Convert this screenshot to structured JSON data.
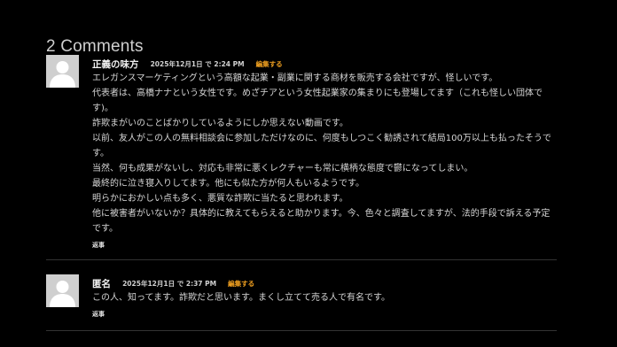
{
  "comments_title": "2 Comments",
  "comments": [
    {
      "author": "正義の味方",
      "date": "2025年12月1日 で 2:24 PM",
      "edit_label": "編集する",
      "paragraphs": [
        "エレガンスマーケティングという高額な起業・副業に関する商材を販売する会社ですが、怪しいです。",
        "代表者は、高橋ナナという女性です。めざチアという女性起業家の集まりにも登場してます（これも怪しい団体です)。",
        "詐欺まがいのことばかりしているようにしか思えない動画です。",
        "以前、友人がこの人の無料相談会に参加しただけなのに、何度もしつこく勧誘されて結局100万以上も払ったそうです。",
        "当然、何も成果がないし、対応も非常に悪くレクチャーも常に横柄な態度で鬱になってしまい。",
        "最終的に泣き寝入りしてます。他にも似た方が何人もいるようです。",
        "明らかにおかしい点も多く、悪質な詐欺に当たると思われます。",
        "他に被害者がいないか？具体的に教えてもらえると助かります。今、色々と調査してますが、法的手段で訴える予定です。"
      ],
      "reply_label": "返事"
    },
    {
      "author": "匿名",
      "date": "2025年12月1日 で 2:37 PM",
      "edit_label": "編集する",
      "paragraphs": [
        "この人、知ってます。詐欺だと思います。まくし立てて売る人で有名です。"
      ],
      "reply_label": "返事"
    }
  ],
  "colors": {
    "background": "#000000",
    "edit_link": "#f0a020",
    "avatar_bg": "#cfcfcf"
  },
  "icons": {
    "avatar": "default-user-avatar-icon"
  }
}
